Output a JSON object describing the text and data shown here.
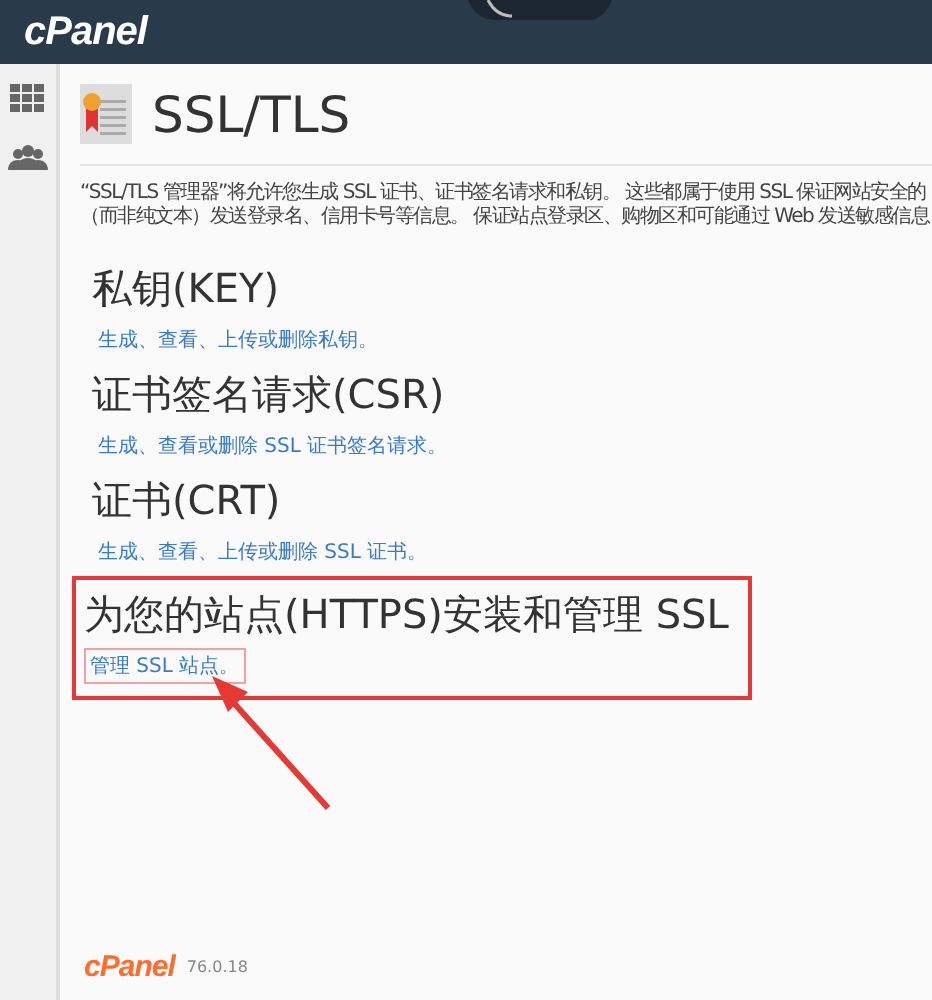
{
  "header": {
    "logo": "cPanel"
  },
  "sidebar": {
    "items": [
      {
        "kind": "grid",
        "selected": false
      },
      {
        "kind": "users",
        "selected": false
      }
    ]
  },
  "page": {
    "title": "SSL/TLS",
    "description": [
      "“SSL/TLS 管理器”将允许您生成 SSL 证书、证书签名请求和私钥。 这些都属于使用 SSL 保证网站安全的",
      "（而非纯文本）发送登录名、信用卡号等信息。 保证站点登录区、购物区和可能通过 Web 发送敏感信息"
    ]
  },
  "sections": [
    {
      "title": "私钥(KEY)",
      "link": "生成、查看、上传或删除私钥。",
      "highlighted": false
    },
    {
      "title": "证书签名请求(CSR)",
      "link": "生成、查看或删除 SSL 证书签名请求。",
      "highlighted": false
    },
    {
      "title": "证书(CRT)",
      "link": "生成、查看、上传或删除 SSL 证书。",
      "highlighted": false
    },
    {
      "title": "为您的站点(HTTPS)安装和管理 SSL",
      "link": "管理 SSL 站点。",
      "highlighted": true
    }
  ],
  "footer": {
    "logo": "cPanel",
    "version": "76.0.18"
  }
}
